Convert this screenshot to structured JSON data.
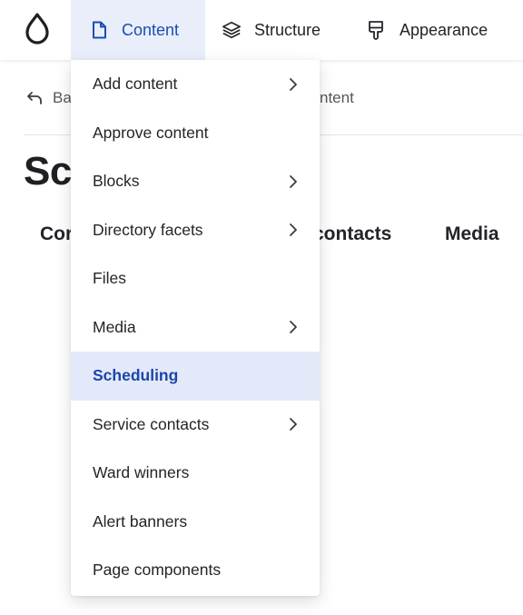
{
  "toolbar": {
    "logo_icon": "drop-icon",
    "items": [
      {
        "label": "Content",
        "icon": "document-icon",
        "active": true
      },
      {
        "label": "Structure",
        "icon": "layers-icon",
        "active": false
      },
      {
        "label": "Appearance",
        "icon": "brush-icon",
        "active": false
      }
    ]
  },
  "breadcrumb": {
    "back_label": "Ba",
    "tail": "ntent"
  },
  "page": {
    "title": "Sc",
    "tabs": [
      "Cor",
      "contacts",
      "Media"
    ]
  },
  "dropdown": {
    "items": [
      {
        "label": "Add content",
        "submenu": true,
        "active": false
      },
      {
        "label": "Approve content",
        "submenu": false,
        "active": false
      },
      {
        "label": "Blocks",
        "submenu": true,
        "active": false
      },
      {
        "label": "Directory facets",
        "submenu": true,
        "active": false
      },
      {
        "label": "Files",
        "submenu": false,
        "active": false
      },
      {
        "label": "Media",
        "submenu": true,
        "active": false
      },
      {
        "label": "Scheduling",
        "submenu": false,
        "active": true
      },
      {
        "label": "Service contacts",
        "submenu": true,
        "active": false
      },
      {
        "label": "Ward winners",
        "submenu": false,
        "active": false
      },
      {
        "label": "Alert banners",
        "submenu": false,
        "active": false
      },
      {
        "label": "Page components",
        "submenu": false,
        "active": false
      }
    ]
  },
  "colors": {
    "accent": "#1b4db3",
    "active_bg": "#e3e9f8",
    "text": "#232429"
  }
}
